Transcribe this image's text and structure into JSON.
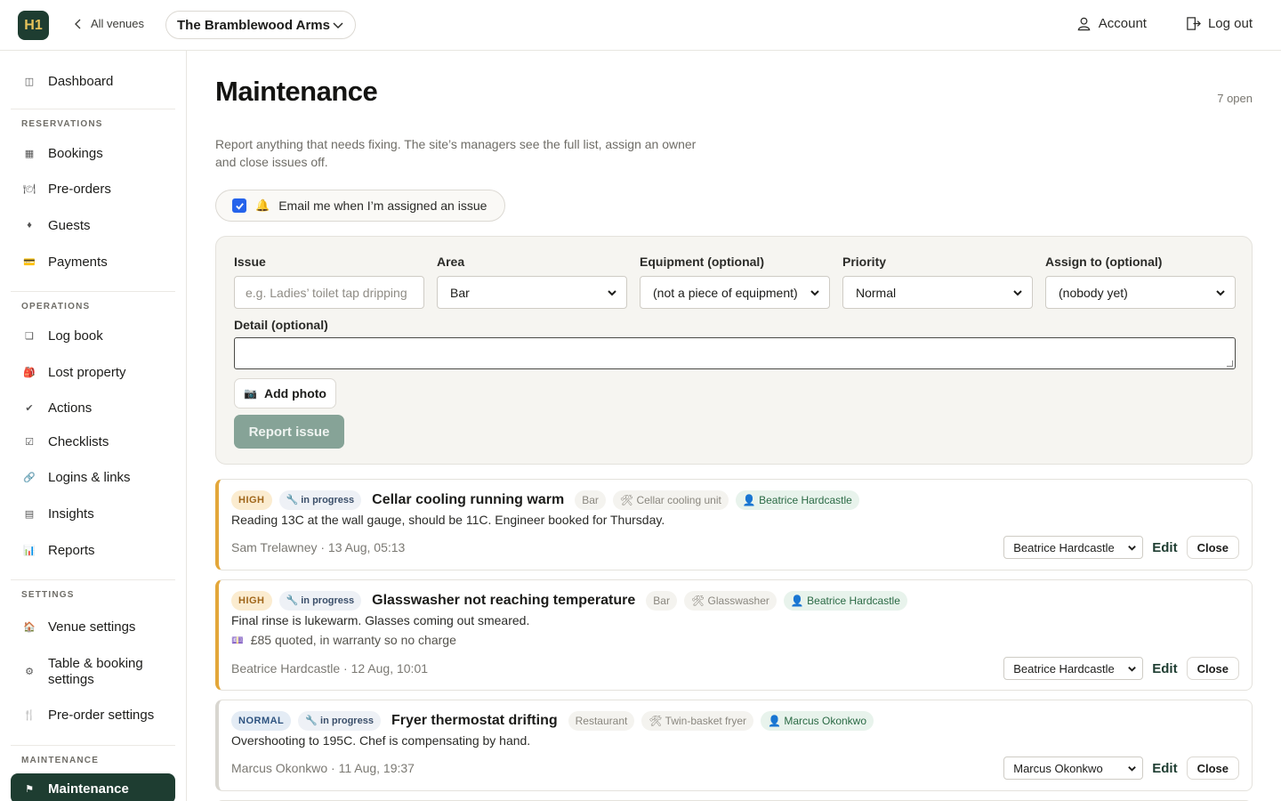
{
  "header": {
    "logo": "H1",
    "back_label": "All venues",
    "venue": "The Bramblewood Arms",
    "account_label": "Account",
    "logout_label": "Log out"
  },
  "sidebar": {
    "dashboard": "Dashboard",
    "sections": {
      "reservations": "RESERVATIONS",
      "operations": "OPERATIONS",
      "settings": "SETTINGS",
      "maintenance": "MAINTENANCE"
    },
    "items": {
      "bookings": "Bookings",
      "preorders": "Pre-orders",
      "guests": "Guests",
      "payments": "Payments",
      "logbook": "Log book",
      "lost_property": "Lost property",
      "actions": "Actions",
      "checklists": "Checklists",
      "logins": "Logins & links",
      "insights": "Insights",
      "reports": "Reports",
      "venue_settings": "Venue settings",
      "table_booking_settings": "Table & booking settings",
      "preorder_settings": "Pre-order settings",
      "maintenance": "Maintenance"
    },
    "icons": {
      "dashboard": "◫",
      "bookings": "▦",
      "preorders": "🍽",
      "guests": "♦",
      "payments": "💳",
      "logbook": "❏",
      "lost_property": "🎒",
      "actions": "✔",
      "checklists": "☑",
      "logins": "🔗",
      "insights": "▤",
      "reports": "📊",
      "venue_settings": "🏠",
      "table_booking_settings": "⚙",
      "preorder_settings": "🍴",
      "maintenance": "⚑"
    }
  },
  "page": {
    "title": "Maintenance",
    "open_count": "7 open",
    "intro": "Report anything that needs fixing. The site’s managers see the full list, assign an owner and close issues off.",
    "email_toggle_label": "Email me when I’m assigned an issue",
    "email_toggle_icon": "🔔"
  },
  "form": {
    "issue_label": "Issue",
    "issue_placeholder": "e.g. Ladies’ toilet tap dripping",
    "area_label": "Area",
    "area_value": "Bar",
    "equipment_label": "Equipment (optional)",
    "equipment_value": "(not a piece of equipment)",
    "priority_label": "Priority",
    "priority_value": "Normal",
    "assign_label": "Assign to (optional)",
    "assign_value": "(nobody yet)",
    "detail_label": "Detail (optional)",
    "add_photo_label": "Add photo",
    "add_photo_icon": "📷",
    "report_label": "Report issue"
  },
  "issues": [
    {
      "priority": "HIGH",
      "status": "🔧 in progress",
      "title": "Cellar cooling running warm",
      "area": "Bar",
      "equipment": "🛠 Cellar cooling unit",
      "assignee_tag": "👤 Beatrice Hardcastle",
      "description": "Reading 13C at the wall gauge, should be 11C. Engineer booked for Thursday.",
      "meta": "Sam Trelawney · 13 Aug, 05:13",
      "assign_select": "Beatrice Hardcastle",
      "edit_label": "Edit",
      "close_label": "Close"
    },
    {
      "priority": "HIGH",
      "status": "🔧 in progress",
      "title": "Glasswasher not reaching temperature",
      "area": "Bar",
      "equipment": "🛠 Glasswasher",
      "assignee_tag": "👤 Beatrice Hardcastle",
      "description": "Final rinse is lukewarm. Glasses coming out smeared.",
      "note_icon": "💷",
      "note": "£85 quoted, in warranty so no charge",
      "meta": "Beatrice Hardcastle · 12 Aug, 10:01",
      "assign_select": "Beatrice Hardcastle",
      "edit_label": "Edit",
      "close_label": "Close"
    },
    {
      "priority": "NORMAL",
      "status": "🔧 in progress",
      "title": "Fryer thermostat drifting",
      "area": "Restaurant",
      "equipment": "🛠 Twin-basket fryer",
      "assignee_tag": "👤 Marcus Okonkwo",
      "description": "Overshooting to 195C. Chef is compensating by hand.",
      "meta": "Marcus Okonkwo · 11 Aug, 19:37",
      "assign_select": "Marcus Okonkwo",
      "edit_label": "Edit",
      "close_label": "Close"
    }
  ]
}
